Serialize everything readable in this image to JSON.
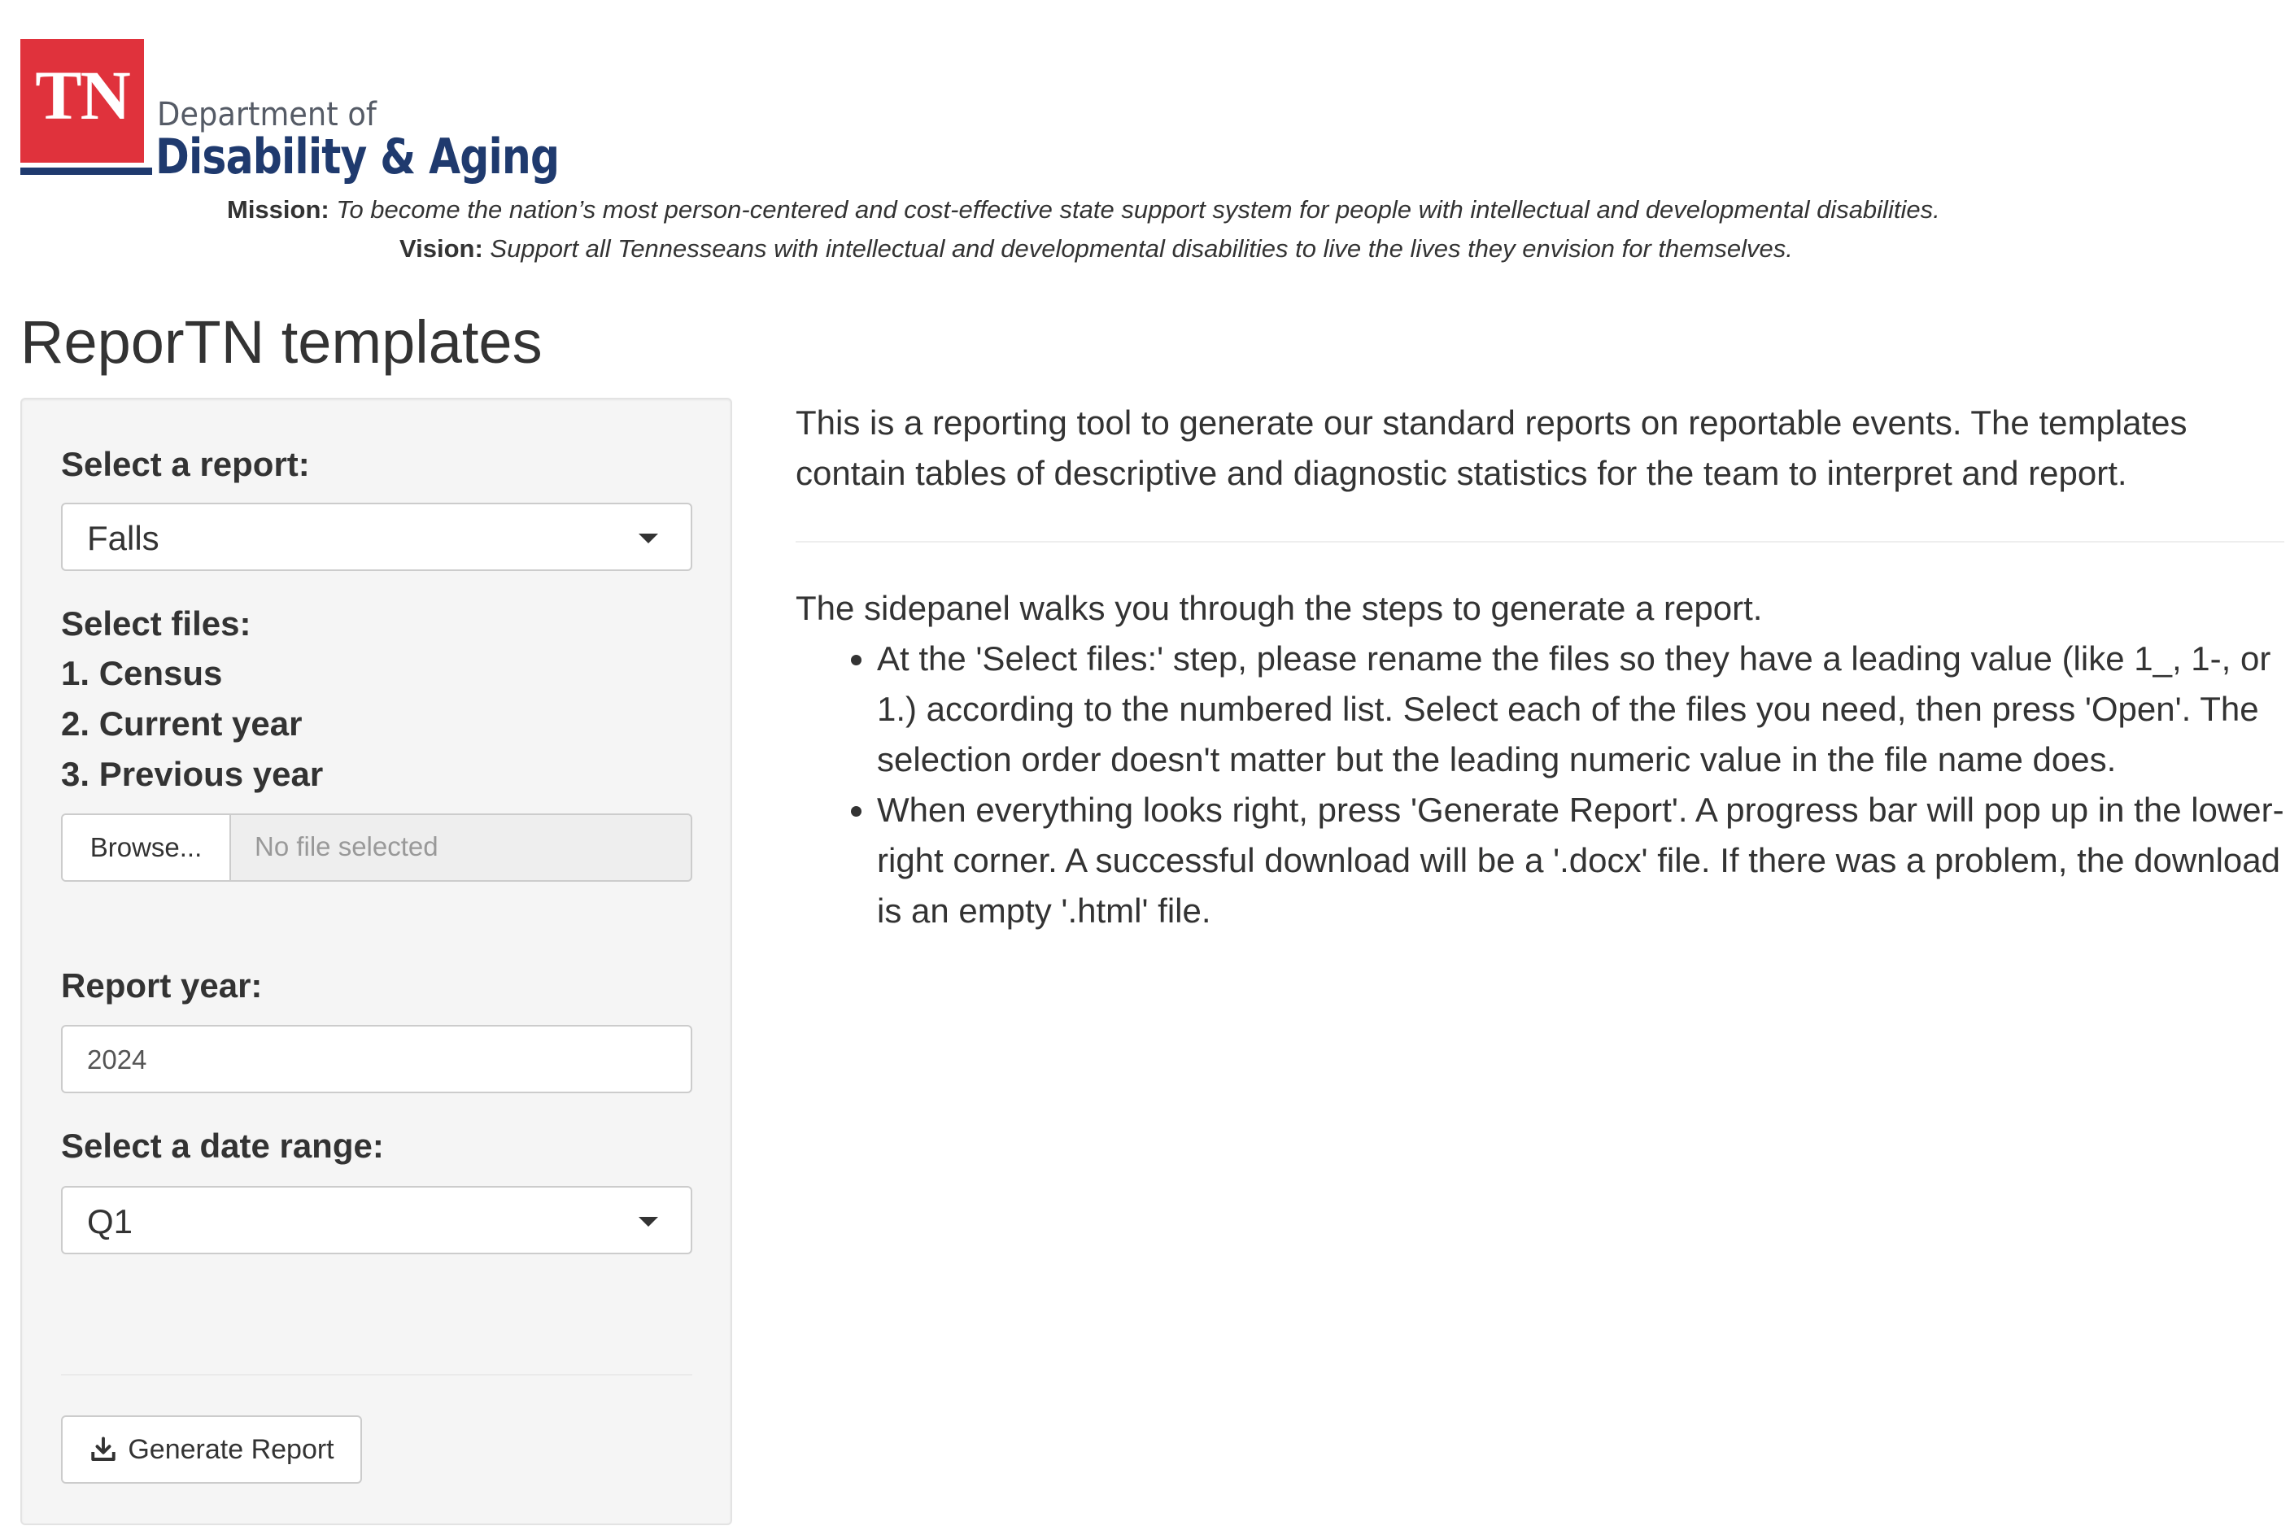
{
  "header": {
    "logo_letters": "TN",
    "dept_prefix": "Department of",
    "dept_name": "Disability & Aging",
    "mission_label": "Mission:",
    "mission_text": "To become the nation’s most person-centered and cost-effective state support system for people with intellectual and developmental disabilities.",
    "vision_label": "Vision:",
    "vision_text": "Support all Tennesseans with intellectual and developmental disabilities to live the lives they envision for themselves."
  },
  "page_title": "ReporTN templates",
  "sidebar": {
    "report_label": "Select a report:",
    "report_selected": "Falls",
    "files_label": "Select files:",
    "files": [
      "1. Census",
      "2. Current year",
      "3. Previous year"
    ],
    "browse_label": "Browse...",
    "file_status": "No file selected",
    "year_label": "Report year:",
    "year_value": "2024",
    "range_label": "Select a date range:",
    "range_selected": "Q1",
    "generate_label": "Generate Report"
  },
  "main": {
    "intro": "This is a reporting tool to generate our standard reports on reportable events. The templates contain tables of descriptive and diagnostic statistics for the team to interpret and report.",
    "steps_intro": "The sidepanel walks you through the steps to generate a report.",
    "steps": [
      "At the 'Select files:' step, please rename the files so they have a leading value (like 1_, 1-, or 1.) according to the numbered list. Select each of the files you need, then press 'Open'. The selection order doesn't matter but the leading numeric value in the file name does.",
      "When everything looks right, press 'Generate Report'. A progress bar will pop up in the lower-right corner. A successful download will be a '.docx' file. If there was a problem, the download is an empty '.html' file."
    ]
  },
  "colors": {
    "logo_red": "#e0323c",
    "logo_blue": "#1f3a6e",
    "panel_bg": "#f5f5f5"
  },
  "icons": {
    "generate": "download-icon",
    "select_caret": "caret-down-icon"
  }
}
